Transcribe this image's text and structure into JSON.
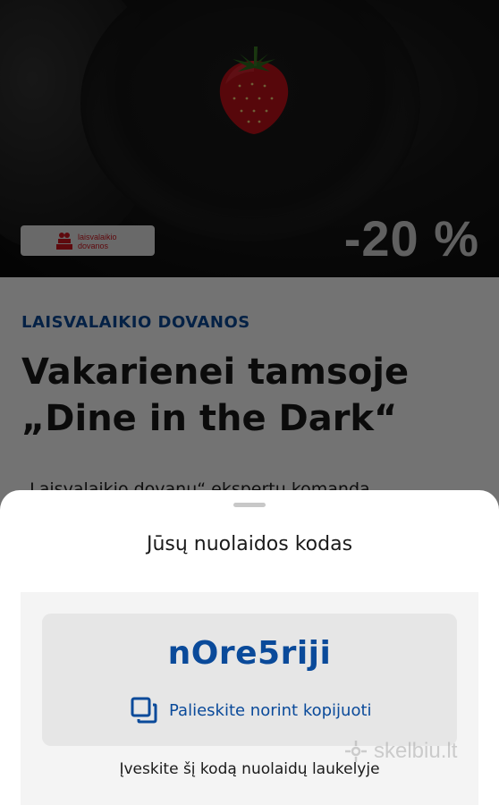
{
  "hero": {
    "badge_text_line1": "laisvalaikio",
    "badge_text_line2": "dovanos",
    "discount": "-20 %"
  },
  "article": {
    "category": "LAISVALAIKIO DOVANOS",
    "title": "Vakarienei tamsoje „Dine in the Dark“",
    "body_partial": "„Laisvalaikio dovanų“ ekspertų komanda"
  },
  "sheet": {
    "heading": "Jūsų nuolaidos kodas",
    "code": "nOre5riji",
    "copy_label": "Palieskite norint kopijuoti",
    "hint": "Įveskite šį kodą nuolaidų laukelyje"
  },
  "watermark": "skelbiu.lt",
  "colors": {
    "accent_blue": "#0a4a9a",
    "brand_red": "#d0141e"
  },
  "icons": {
    "copy": "copy-icon",
    "strawberry": "strawberry-image",
    "logo": "gift-logo-icon"
  }
}
